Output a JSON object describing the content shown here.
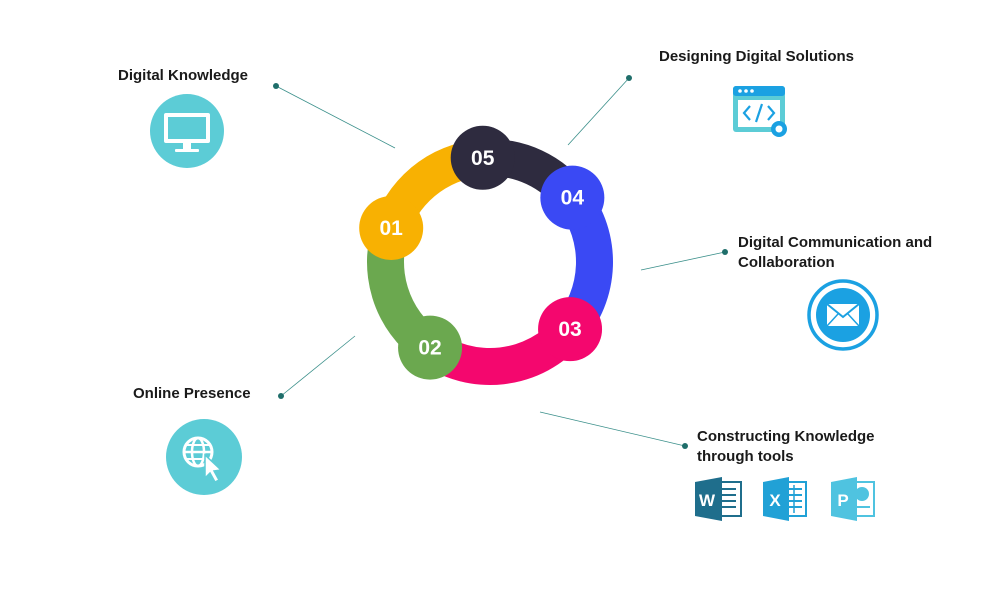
{
  "stages": [
    {
      "number": "01",
      "label": "Digital Knowledge",
      "color": "#F8B102",
      "icon": "monitor-icon"
    },
    {
      "number": "02",
      "label": "Online Presence",
      "color": "#6BA84F",
      "icon": "web-click-icon"
    },
    {
      "number": "03",
      "label": "Constructing Knowledge through tools",
      "color": "#F4076E",
      "icon": "office-apps-icon"
    },
    {
      "number": "04",
      "label": "Digital Communication and Collaboration",
      "color": "#3A49F4",
      "icon": "envelope-icon"
    },
    {
      "number": "05",
      "label": "Designing Digital Solutions",
      "color": "#2E2B3F",
      "icon": "code-window-icon"
    }
  ],
  "labels": {
    "l1": "Digital Knowledge",
    "l2": "Online Presence",
    "l3a": "Constructing Knowledge",
    "l3b": "through tools",
    "l4a": "Digital Communication and",
    "l4b": "Collaboration",
    "l5": "Designing Digital Solutions"
  },
  "app_letters": {
    "word": "W",
    "excel": "X",
    "powerpoint": "P"
  },
  "accent_teal": "#5CCCD6",
  "accent_blue": "#1BA1E2",
  "word_color": "#1F6E8C",
  "excel_color": "#21A1D6",
  "ppt_color": "#4FC3E0"
}
